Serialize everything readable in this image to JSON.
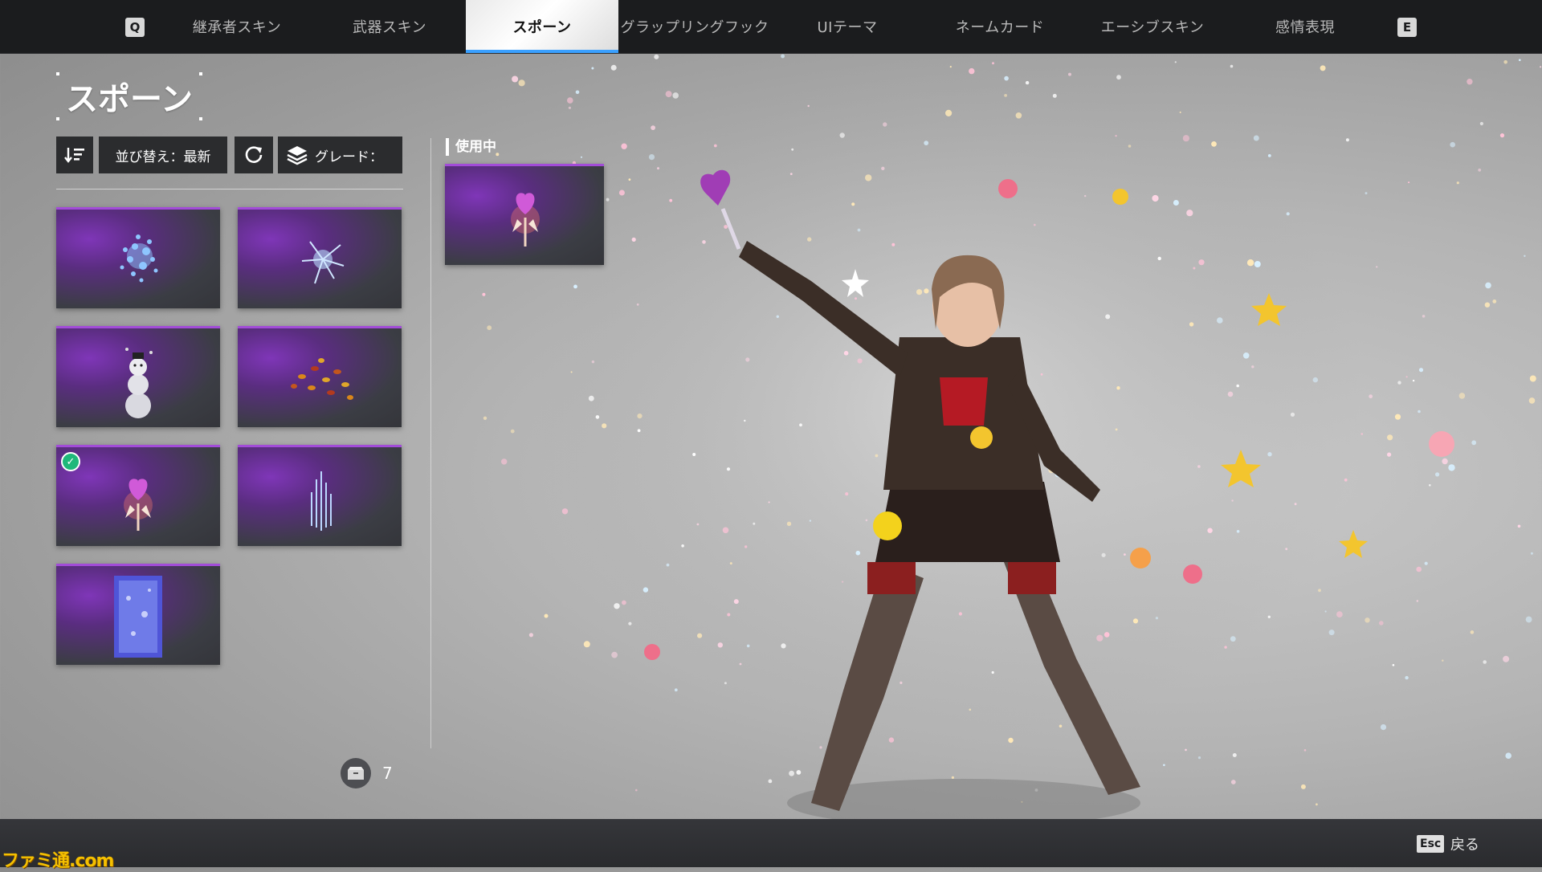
{
  "nav": {
    "left_key": "Q",
    "right_key": "E",
    "tabs": [
      {
        "label": "継承者スキン"
      },
      {
        "label": "武器スキン"
      },
      {
        "label": "スポーン"
      },
      {
        "label": "グラップリングフック"
      },
      {
        "label": "UIテーマ"
      },
      {
        "label": "ネームカード"
      },
      {
        "label": "エーシブスキン"
      },
      {
        "label": "感情表現"
      }
    ],
    "active_tab": "スポーン"
  },
  "panel": {
    "title": "スポーン",
    "sort_label": "並び替え：最新",
    "grade_label": "グレード：",
    "in_use_label": "使用中",
    "item_count": "7"
  },
  "items": [
    {
      "icon": "blue-crystal-burst-icon",
      "equipped": false
    },
    {
      "icon": "blue-lightning-icon",
      "equipped": false
    },
    {
      "icon": "snowman-icon",
      "equipped": false
    },
    {
      "icon": "autumn-leaves-icon",
      "equipped": false
    },
    {
      "icon": "heart-wand-icon",
      "equipped": true
    },
    {
      "icon": "blue-fountain-icon",
      "equipped": false
    },
    {
      "icon": "blue-portal-icon",
      "equipped": false
    }
  ],
  "in_use_item": {
    "icon": "heart-wand-icon"
  },
  "footer": {
    "esc_key": "Esc",
    "back_label": "戻る",
    "watermark": "ファミ通.com"
  },
  "colors": {
    "accent": "#3aa0ff",
    "card_rarity": "#a24cd8",
    "equipped_check": "#1fb87a"
  }
}
